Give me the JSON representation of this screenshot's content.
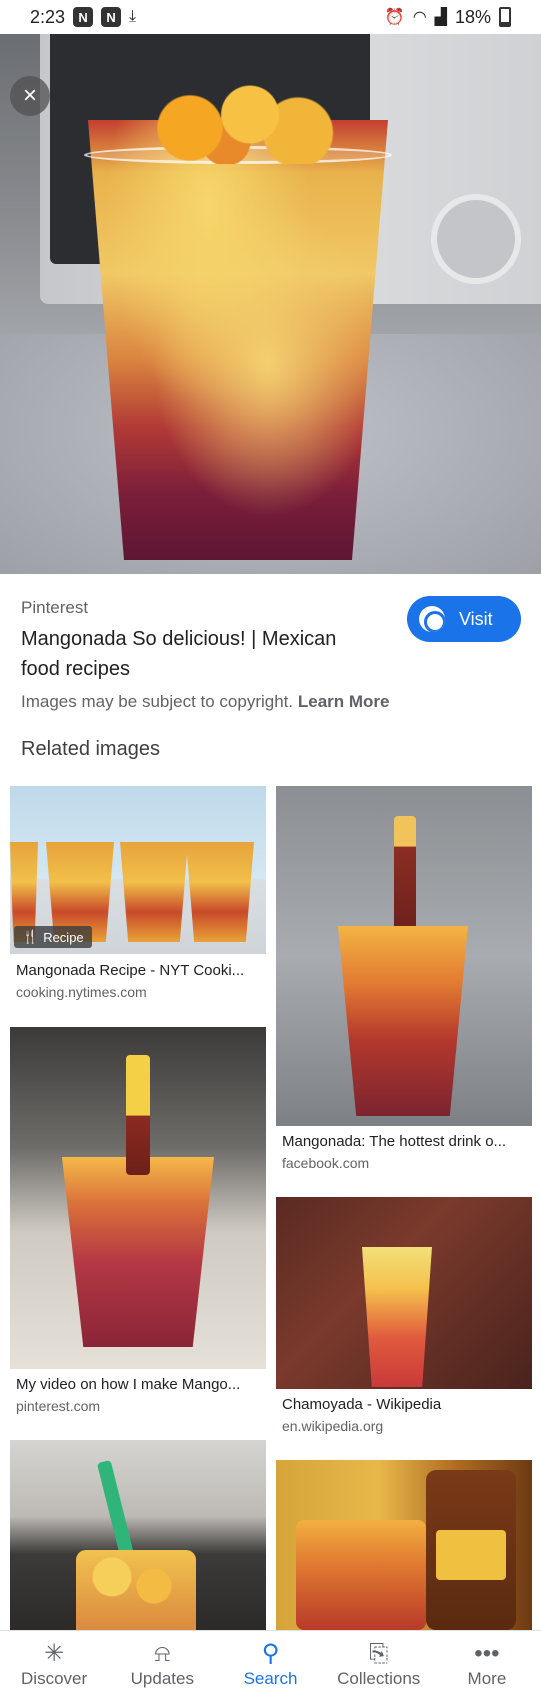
{
  "status_bar": {
    "time": "2:23",
    "battery": "18%",
    "left_icons": [
      "n-notification-icon",
      "n-notification-icon",
      "download-icon"
    ],
    "right_icons": [
      "alarm-icon",
      "wifi-icon",
      "signal-icon",
      "battery-icon"
    ]
  },
  "hero": {
    "close_icon": "×"
  },
  "result": {
    "source": "Pinterest",
    "title": "Mangonada So delicious! | Mexican food recipes",
    "visit_label": "Visit",
    "copyright_text": "Images may be subject to copyright.",
    "learn_more": "Learn More"
  },
  "related": {
    "heading": "Related images",
    "items": [
      {
        "title": "Mangonada Recipe - NYT Cooki...",
        "site": "cooking.nytimes.com",
        "badge": "Recipe"
      },
      {
        "title": "Mangonada: The hottest drink o...",
        "site": "facebook.com"
      },
      {
        "title": "My video on how I make Mango...",
        "site": "pinterest.com"
      },
      {
        "title": "Chamoyada - Wikipedia",
        "site": "en.wikipedia.org"
      }
    ]
  },
  "bottom_nav": {
    "items": [
      {
        "label": "Discover",
        "icon": "✳"
      },
      {
        "label": "Updates",
        "icon": "⍾"
      },
      {
        "label": "Search",
        "icon": "⚲"
      },
      {
        "label": "Collections",
        "icon": "⎘"
      },
      {
        "label": "More",
        "icon": "•••"
      }
    ]
  }
}
